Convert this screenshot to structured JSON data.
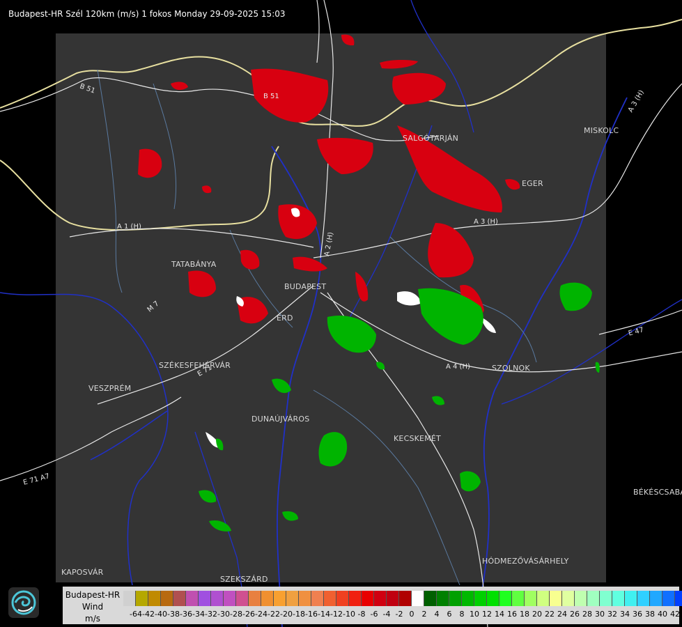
{
  "header": {
    "title": "Budapest-HR Szél 120km (m/s) 1 fokos Monday 29-09-2025 15:03"
  },
  "map": {
    "cities": [
      {
        "name": "SALGÓTARJÁN",
        "key": "salgotarjan"
      },
      {
        "name": "MISKOLC",
        "key": "miskolc"
      },
      {
        "name": "EGER",
        "key": "eger"
      },
      {
        "name": "TATABÁNYA",
        "key": "tatabanya"
      },
      {
        "name": "BUDAPEST",
        "key": "budapest"
      },
      {
        "name": "ÉRD",
        "key": "erd"
      },
      {
        "name": "SZÉKESFEHÉRVÁR",
        "key": "szekesfehervar"
      },
      {
        "name": "VESZPRÉM",
        "key": "veszprem"
      },
      {
        "name": "DUNAÚJVÁROS",
        "key": "dunaujvaros"
      },
      {
        "name": "KECSKEMÉT",
        "key": "kecskemet"
      },
      {
        "name": "SZOLNOK",
        "key": "szolnok"
      },
      {
        "name": "BÉKÉSCSABA",
        "key": "bekescsaba"
      },
      {
        "name": "HÓDMEZŐVÁSÁRHELY",
        "key": "hodmezovasarhely"
      },
      {
        "name": "KAPOSVÁR",
        "key": "kaposvar"
      },
      {
        "name": "SZEKSZÁRD",
        "key": "szekszard"
      }
    ],
    "roads": [
      "B 51",
      "B 51",
      "A 1 (H)",
      "A 3 (H)",
      "A 3 (H)",
      "A 2 (H)",
      "A 4 (H)",
      "E 71",
      "E 71 A7",
      "E 47",
      "M 7"
    ]
  },
  "legend": {
    "station": "Budapest-HR",
    "product": "Wind",
    "unit": "m/s",
    "colors": [
      "#d0d0d0",
      "#b5a800",
      "#c08a00",
      "#b86a10",
      "#b05050",
      "#c050b0",
      "#a050e0",
      "#b050d0",
      "#c050c0",
      "#d05090",
      "#e88040",
      "#f09030",
      "#f8a030",
      "#f0a040",
      "#f09040",
      "#f08050",
      "#f06030",
      "#f04020",
      "#f02010",
      "#e80000",
      "#d00010",
      "#c00010",
      "#b00000",
      "#ffffff",
      "#006000",
      "#008000",
      "#00a000",
      "#00b800",
      "#00d000",
      "#00e000",
      "#20ff20",
      "#60ff40",
      "#a0ff60",
      "#d0ff80",
      "#f8ff90",
      "#e0ffa0",
      "#c0ffb0",
      "#a0ffc0",
      "#80ffd0",
      "#60ffe0",
      "#40f0f0",
      "#30d0ff",
      "#20a8ff",
      "#1070ff",
      "#0040ff",
      "#0000f0"
    ],
    "labels": [
      "-64",
      "-42",
      "-40",
      "-38",
      "-36",
      "-34",
      "-32",
      "-30",
      "-28",
      "-26",
      "-24",
      "-22",
      "-20",
      "-18",
      "-16",
      "-14",
      "-12",
      "-10",
      "-8",
      "-6",
      "-4",
      "-2",
      "0",
      "2",
      "4",
      "6",
      "8",
      "10",
      "12",
      "14",
      "16",
      "18",
      "20",
      "22",
      "24",
      "26",
      "28",
      "30",
      "32",
      "34",
      "36",
      "38",
      "40",
      "42"
    ]
  }
}
